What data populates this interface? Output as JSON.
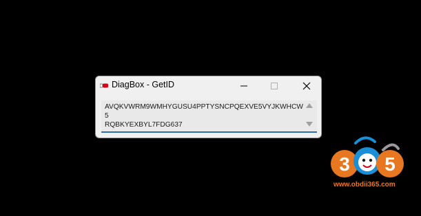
{
  "window": {
    "title": "DiagBox - GetID",
    "app_icon": "diagbox-app-icon",
    "minimize_icon": "minimize-icon",
    "maximize_icon": "maximize-icon",
    "close_icon": "close-icon"
  },
  "id_field": {
    "value": "AVQKVWRM9WMHYGUSU4PPTYSNCPQEXVE5VYJKWHCW5\nRQBKYEXBYL7FDG637",
    "scroll_up_icon": "scroll-up-arrow-icon",
    "scroll_down_icon": "scroll-down-arrow-icon"
  },
  "watermark": {
    "logo_text": "365",
    "url": "www.obdii365.com",
    "brand_colors": {
      "orange": "#e87722",
      "blue": "#1a8fd8"
    }
  },
  "colors": {
    "desktop_background": "#000000",
    "window_background": "#f0f0f0",
    "field_background": "#e9e9e9",
    "focus_underline": "#2e6db4"
  }
}
